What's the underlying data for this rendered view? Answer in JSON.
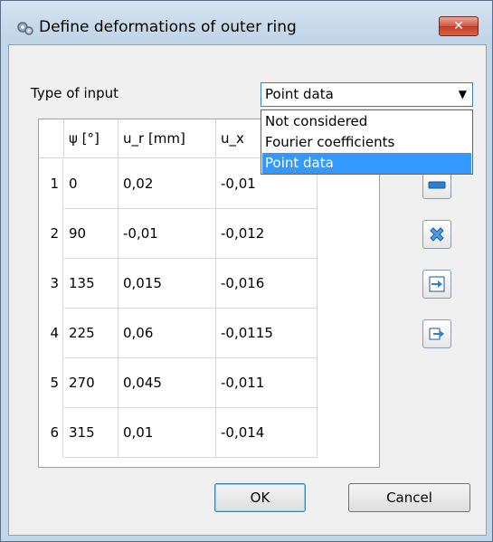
{
  "window": {
    "title": "Define deformations of outer ring",
    "close_label": "✕"
  },
  "input_type": {
    "label": "Type of input",
    "selected": "Point data",
    "options": [
      "Not considered",
      "Fourier coefficients",
      "Point data"
    ]
  },
  "table": {
    "headers": [
      "ψ [°]",
      "u_r [mm]",
      "u_x"
    ],
    "rows": [
      {
        "n": "1",
        "psi": "0",
        "ur": "0,02",
        "ux": "-0,01"
      },
      {
        "n": "2",
        "psi": "90",
        "ur": "-0,01",
        "ux": "-0,012"
      },
      {
        "n": "3",
        "psi": "135",
        "ur": "0,015",
        "ux": "-0,016"
      },
      {
        "n": "4",
        "psi": "225",
        "ur": "0,06",
        "ux": "-0,0115"
      },
      {
        "n": "5",
        "psi": "270",
        "ur": "0,045",
        "ux": "-0,011"
      },
      {
        "n": "6",
        "psi": "315",
        "ur": "0,01",
        "ux": "-0,014"
      }
    ]
  },
  "side_buttons": [
    "remove-row-icon",
    "delete-icon",
    "import-icon",
    "export-icon"
  ],
  "buttons": {
    "ok": "OK",
    "cancel": "Cancel"
  },
  "colors": {
    "selection": "#3399ff",
    "close": "#c23b22"
  }
}
